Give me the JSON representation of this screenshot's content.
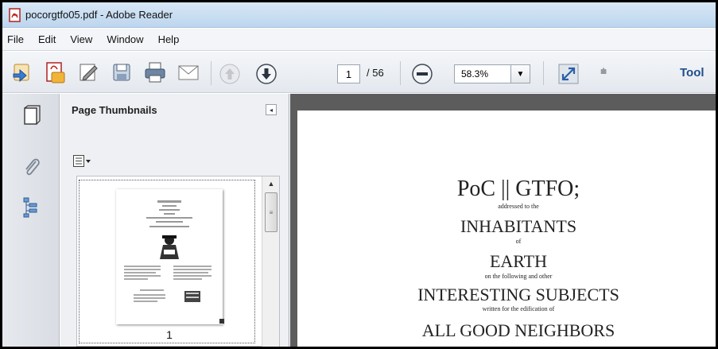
{
  "window": {
    "title": "pocorgtfo05.pdf - Adobe Reader"
  },
  "menu": [
    "File",
    "Edit",
    "View",
    "Window",
    "Help"
  ],
  "toolbar": {
    "page_current": "1",
    "page_total": "/ 56",
    "zoom": "58.3%",
    "tools_label": "Tool",
    "icons": [
      "create-icon",
      "convert-icon",
      "sign-icon",
      "save-icon",
      "print-icon",
      "email-icon",
      "previous-page-icon",
      "next-page-icon",
      "zoom-out-icon",
      "fullscreen-icon",
      "customize-icon"
    ]
  },
  "nav_panel": {
    "title": "Page Thumbnails",
    "thumbnail_page_label": "1"
  },
  "document": {
    "lines": [
      "PoC || GTFO;",
      "addressed to the",
      "INHABITANTS",
      "of",
      "EARTH",
      "on the following and other",
      "INTERESTING SUBJECTS",
      "written for the edification of",
      "ALL GOOD NEIGHBORS"
    ]
  },
  "colors": {
    "title_bar": "#c9ddf1",
    "doc_background": "#5c5c5c",
    "tools_label": "#1f4e8c"
  }
}
